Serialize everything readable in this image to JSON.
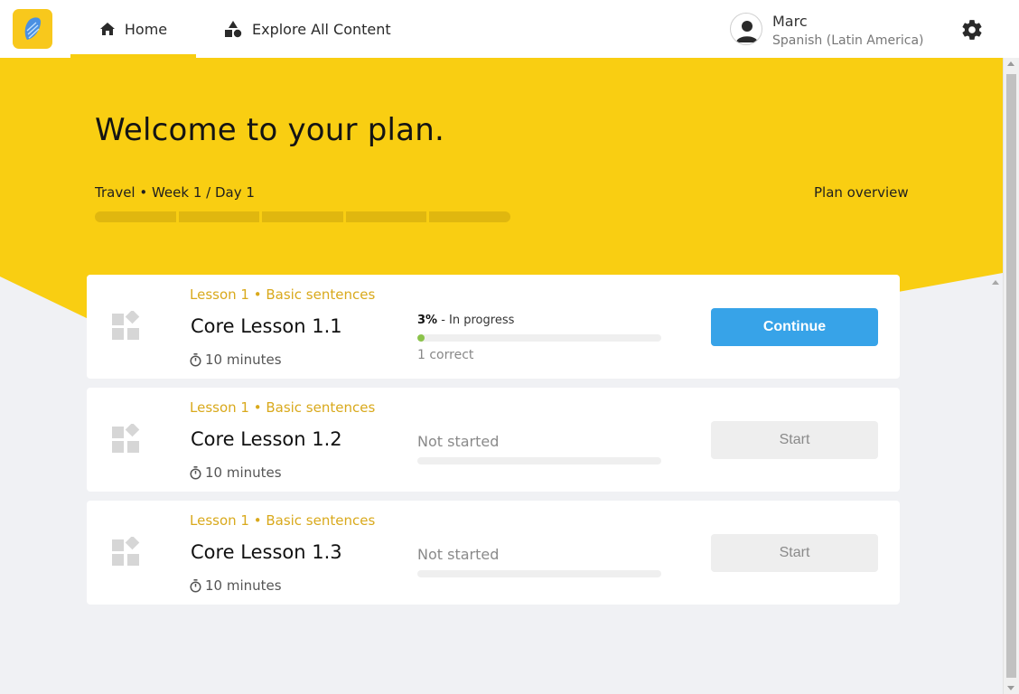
{
  "header": {
    "nav": [
      {
        "label": "Home",
        "icon": "home-icon",
        "active": true
      },
      {
        "label": "Explore All Content",
        "icon": "shapes-icon",
        "active": false
      }
    ],
    "user": {
      "name": "Marc",
      "language": "Spanish (Latin America)"
    },
    "colors": {
      "brand": "#f8c81c",
      "accent_underline": "#f8cd10"
    }
  },
  "hero": {
    "title": "Welcome to your plan.",
    "subtitle": "Travel • Week 1 / Day 1",
    "plan_overview": "Plan overview",
    "week_segments": 5,
    "background": "#f9ce12"
  },
  "lessons": [
    {
      "kicker": "Lesson 1 • Basic sentences",
      "title": "Core Lesson 1.1",
      "duration": "10 minutes",
      "status": "in_progress",
      "percent_label": "3%",
      "status_label": " - In progress",
      "progress": 0.03,
      "note": "1 correct",
      "button": "Continue"
    },
    {
      "kicker": "Lesson 1 • Basic sentences",
      "title": "Core Lesson 1.2",
      "duration": "10 minutes",
      "status": "not_started",
      "status_label": "Not started",
      "progress": 0,
      "button": "Start"
    },
    {
      "kicker": "Lesson 1 • Basic sentences",
      "title": "Core Lesson 1.3",
      "duration": "10 minutes",
      "status": "not_started",
      "status_label": "Not started",
      "progress": 0,
      "button": "Start"
    }
  ]
}
